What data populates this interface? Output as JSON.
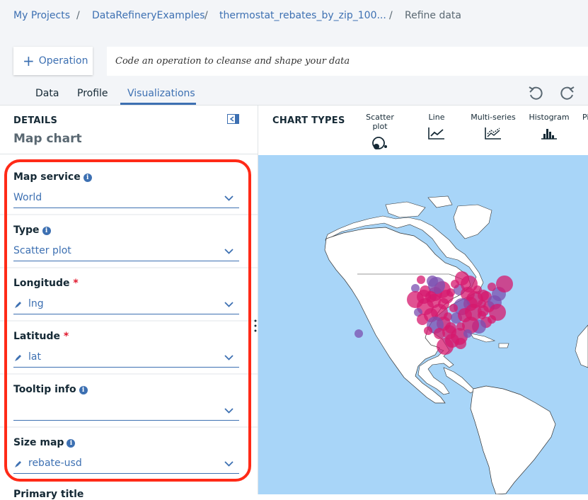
{
  "breadcrumb": {
    "items": [
      "My Projects",
      "DataRefineryExamples",
      "thermostat_rebates_by_zip_100...",
      "Refine data"
    ],
    "separator": "/"
  },
  "operation": {
    "button_label": "Operation",
    "input_placeholder": "Code an operation to cleanse and shape your data"
  },
  "tabs": [
    "Data",
    "Profile",
    "Visualizations"
  ],
  "details": {
    "heading": "DETAILS",
    "subtitle": "Map chart",
    "fields": {
      "map_service": {
        "label": "Map service",
        "value": "World"
      },
      "type": {
        "label": "Type",
        "value": "Scatter plot"
      },
      "longitude": {
        "label": "Longitude",
        "value": "lng",
        "required": "*"
      },
      "latitude": {
        "label": "Latitude",
        "value": "lat",
        "required": "*"
      },
      "tooltip_info": {
        "label": "Tooltip info",
        "value": ""
      },
      "size_map": {
        "label": "Size map",
        "value": "rebate-usd"
      }
    },
    "cut_label": "Primary title"
  },
  "chart_types": {
    "heading": "CHART TYPES",
    "items": [
      "Scatter plot",
      "Line",
      "Multi-series",
      "Histogram",
      "Pi"
    ]
  },
  "colors": {
    "accent": "#3d70b2",
    "highlight": "#ff2a17",
    "ocean": "#a8d5f8",
    "point": "#d6186e",
    "point_alt": "#7b4fb0"
  }
}
